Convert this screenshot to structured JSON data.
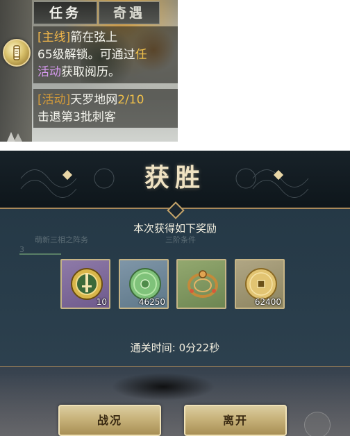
{
  "quest_panel": {
    "tabs": [
      {
        "label": "任务"
      },
      {
        "label": "奇遇"
      }
    ],
    "main_quest": {
      "tag": "[主线]",
      "title": "箭在弦上",
      "line2_a": "65级解锁。可通过",
      "line2_b": "任",
      "line3_a": "活动",
      "line3_b": "获取阅历。"
    },
    "event_quest": {
      "tag": "[活动]",
      "title": "天罗地网",
      "progress": "2/10",
      "objective": "击退第3批刺客"
    }
  },
  "victory": {
    "title": "获胜",
    "reward_heading": "本次获得如下奖励",
    "background_text": {
      "line1": "萌新三相之阵务",
      "line2": "3",
      "line3": "三阶条件"
    },
    "rewards": [
      {
        "icon": "sword-coin-icon",
        "quantity": "10"
      },
      {
        "icon": "jade-disc-icon",
        "quantity": "46250"
      },
      {
        "icon": "bronze-ring-icon",
        "quantity": ""
      },
      {
        "icon": "copper-coin-icon",
        "quantity": "62400"
      }
    ],
    "clear_time": "通关时间: 0分22秒",
    "buttons": {
      "status": "战况",
      "leave": "离开"
    }
  },
  "colors": {
    "gold_text": "#f0c04a",
    "purple_text": "#d79af0",
    "button_gold": "#c7b27a",
    "panel_blue": "#263a48"
  }
}
